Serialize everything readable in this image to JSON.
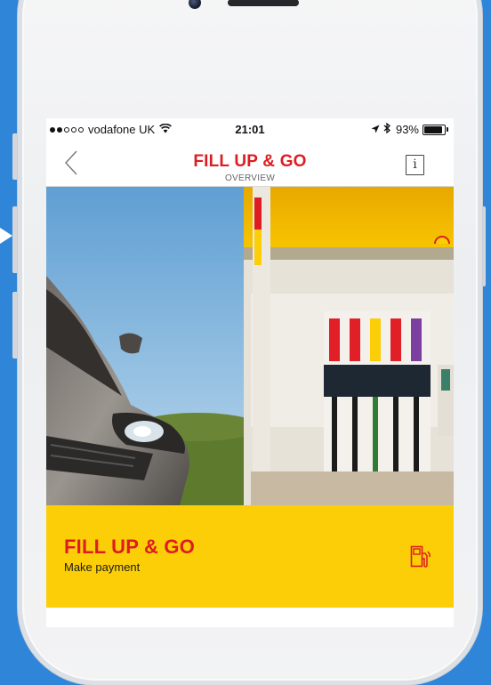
{
  "status_bar": {
    "carrier": "vodafone UK",
    "time": "21:01",
    "battery": "93%",
    "battery_level": 0.93,
    "signal_bars": 2,
    "signal_total": 5
  },
  "nav": {
    "title": "FILL UP & GO",
    "subtitle": "OVERVIEW",
    "back_icon": "chevron-left-icon",
    "info_icon_label": "i"
  },
  "hero": {
    "brand_logo": "shell-pecten",
    "pump_colors": [
      "#e11f26",
      "#e11f26",
      "#fbce07",
      "#e11f26",
      "#7b3fa0"
    ]
  },
  "cta": {
    "title": "FILL UP & GO",
    "subtitle": "Make payment",
    "icon": "fuel-pump-icon"
  },
  "colors": {
    "brand_red": "#dd1d21",
    "brand_yellow": "#fbce07",
    "background_blue": "#2f86d9"
  }
}
